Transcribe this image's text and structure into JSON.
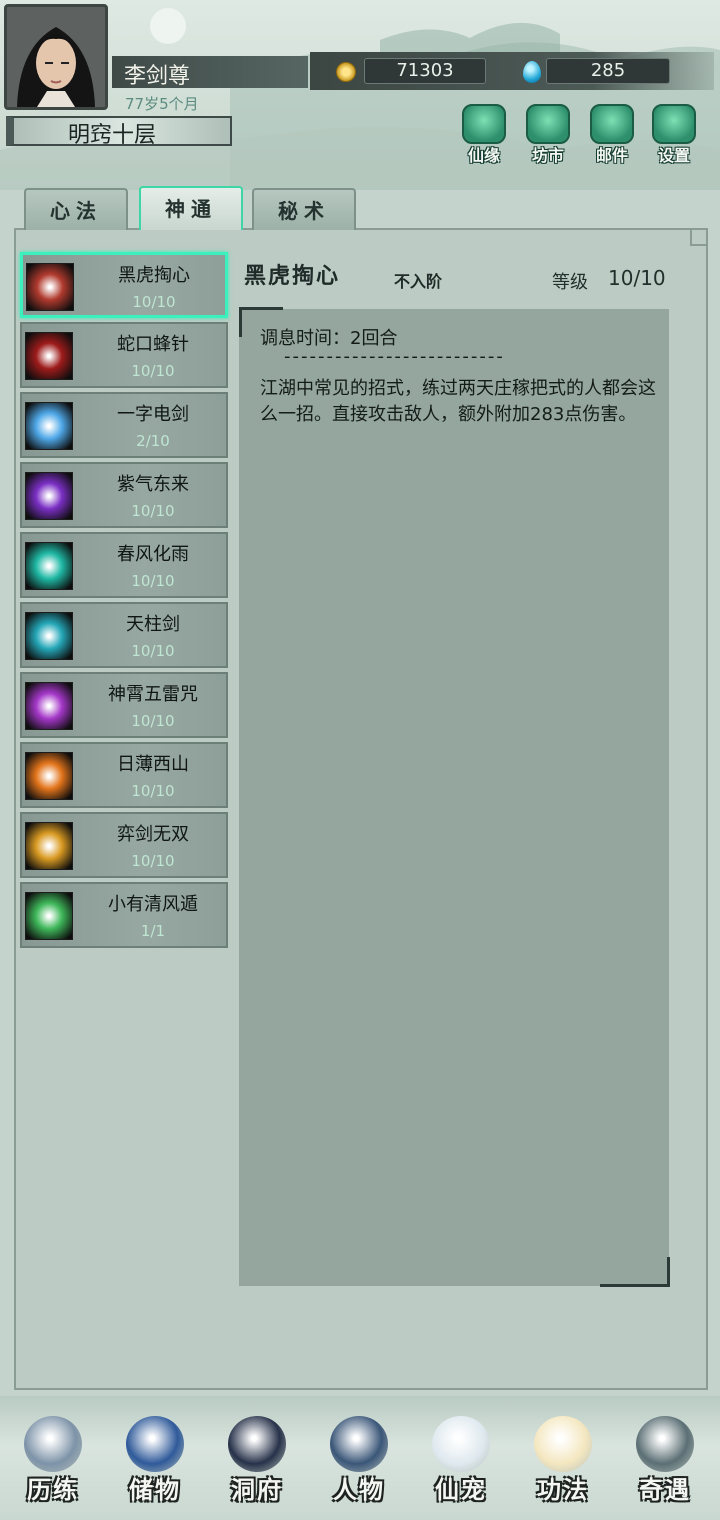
{
  "player": {
    "name": "李剑尊",
    "age": "77岁5个月",
    "realm": "明窍十层",
    "coins": "71303",
    "gems": "285"
  },
  "top_buttons": [
    {
      "label": "仙缘",
      "icon": "cloud-icon"
    },
    {
      "label": "坊市",
      "icon": "pavilion-icon"
    },
    {
      "label": "邮件",
      "icon": "mail-icon"
    },
    {
      "label": "设置",
      "icon": "gear-icon"
    }
  ],
  "tabs": [
    {
      "label": "心法",
      "active": false
    },
    {
      "label": "神通",
      "active": true
    },
    {
      "label": "秘术",
      "active": false
    }
  ],
  "skills": [
    {
      "name": "黑虎掏心",
      "level": "10/10",
      "color": "#b03a2e",
      "selected": true
    },
    {
      "name": "蛇口蜂针",
      "level": "10/10",
      "color": "#9e1b1b"
    },
    {
      "name": "一字电剑",
      "level": "2/10",
      "color": "#4fa8e8"
    },
    {
      "name": "紫气东来",
      "level": "10/10",
      "color": "#7a2fc4"
    },
    {
      "name": "春风化雨",
      "level": "10/10",
      "color": "#1fb8a4"
    },
    {
      "name": "天柱剑",
      "level": "10/10",
      "color": "#25a7b8"
    },
    {
      "name": "神霄五雷咒",
      "level": "10/10",
      "color": "#a437c8"
    },
    {
      "name": "日薄西山",
      "level": "10/10",
      "color": "#e2741b"
    },
    {
      "name": "弈剑无双",
      "level": "10/10",
      "color": "#d99a22"
    },
    {
      "name": "小有清风遁",
      "level": "1/1",
      "color": "#3fb85a"
    }
  ],
  "detail": {
    "title": "黑虎掏心",
    "tier": "不入阶",
    "grade_label": "等级",
    "grade_value": "10/10",
    "cooldown": "调息时间：2回合",
    "divider": "--------------------------",
    "description": "江湖中常见的招式，练过两天庄稼把式的人都会这么一招。直接攻击敌人，额外附加283点伤害。"
  },
  "bottom_nav": [
    {
      "label": "历练",
      "icon": "mountain-icon"
    },
    {
      "label": "储物",
      "icon": "bag-icon"
    },
    {
      "label": "洞府",
      "icon": "pagoda-icon"
    },
    {
      "label": "人物",
      "icon": "character-icon"
    },
    {
      "label": "仙宠",
      "icon": "ghost-pet-icon"
    },
    {
      "label": "功法",
      "icon": "scroll-icon"
    },
    {
      "label": "奇遇",
      "icon": "brush-icon"
    }
  ]
}
